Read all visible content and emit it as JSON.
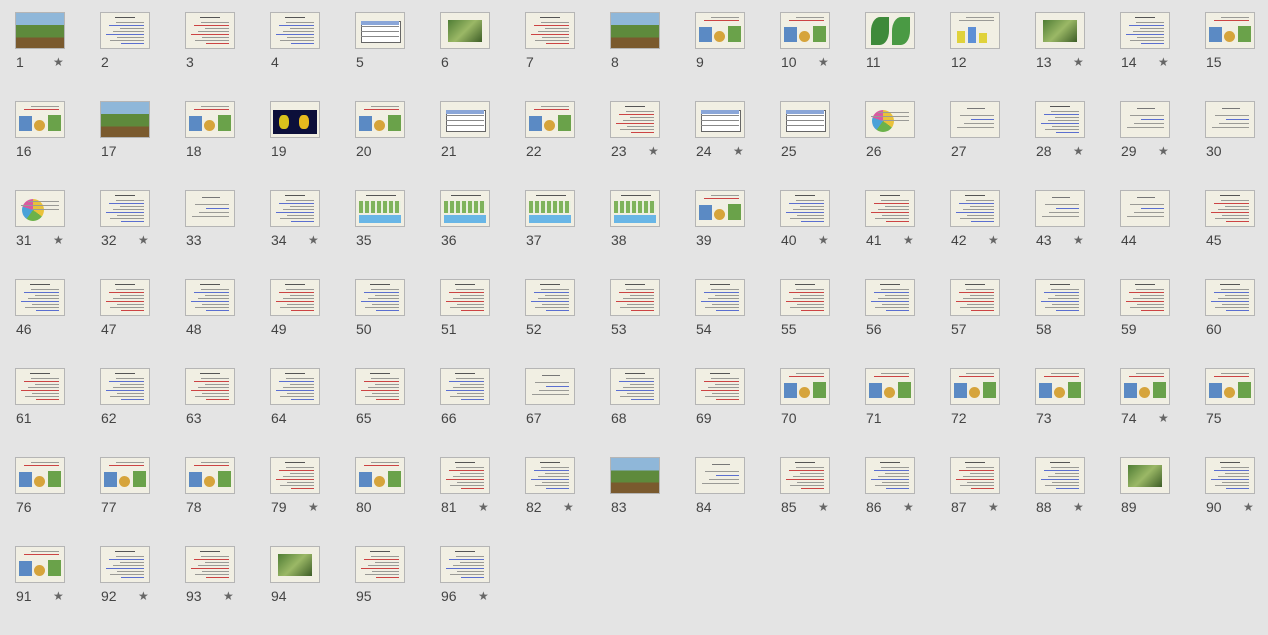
{
  "slides": [
    {
      "number": "1",
      "starred": true,
      "style": "photo"
    },
    {
      "number": "2",
      "starred": false,
      "style": "text"
    },
    {
      "number": "3",
      "starred": false,
      "style": "text"
    },
    {
      "number": "4",
      "starred": false,
      "style": "text"
    },
    {
      "number": "5",
      "starred": false,
      "style": "table"
    },
    {
      "number": "6",
      "starred": false,
      "style": "photo-small"
    },
    {
      "number": "7",
      "starred": false,
      "style": "text"
    },
    {
      "number": "8",
      "starred": false,
      "style": "photo"
    },
    {
      "number": "9",
      "starred": false,
      "style": "images"
    },
    {
      "number": "10",
      "starred": true,
      "style": "images"
    },
    {
      "number": "11",
      "starred": false,
      "style": "leaves"
    },
    {
      "number": "12",
      "starred": false,
      "style": "chart"
    },
    {
      "number": "13",
      "starred": true,
      "style": "photo-small"
    },
    {
      "number": "14",
      "starred": true,
      "style": "text"
    },
    {
      "number": "15",
      "starred": false,
      "style": "images"
    },
    {
      "number": "16",
      "starred": false,
      "style": "images"
    },
    {
      "number": "17",
      "starred": false,
      "style": "photo"
    },
    {
      "number": "18",
      "starred": false,
      "style": "images"
    },
    {
      "number": "19",
      "starred": false,
      "style": "dark"
    },
    {
      "number": "20",
      "starred": false,
      "style": "images"
    },
    {
      "number": "21",
      "starred": false,
      "style": "table"
    },
    {
      "number": "22",
      "starred": false,
      "style": "images"
    },
    {
      "number": "23",
      "starred": true,
      "style": "text"
    },
    {
      "number": "24",
      "starred": true,
      "style": "table"
    },
    {
      "number": "25",
      "starred": false,
      "style": "table"
    },
    {
      "number": "26",
      "starred": false,
      "style": "pie"
    },
    {
      "number": "27",
      "starred": false,
      "style": "text-sparse"
    },
    {
      "number": "28",
      "starred": true,
      "style": "text"
    },
    {
      "number": "29",
      "starred": true,
      "style": "text-sparse"
    },
    {
      "number": "30",
      "starred": false,
      "style": "text-sparse"
    },
    {
      "number": "31",
      "starred": true,
      "style": "pie"
    },
    {
      "number": "32",
      "starred": true,
      "style": "text"
    },
    {
      "number": "33",
      "starred": false,
      "style": "text-sparse"
    },
    {
      "number": "34",
      "starred": true,
      "style": "text"
    },
    {
      "number": "35",
      "starred": false,
      "style": "diagram"
    },
    {
      "number": "36",
      "starred": false,
      "style": "diagram"
    },
    {
      "number": "37",
      "starred": false,
      "style": "diagram"
    },
    {
      "number": "38",
      "starred": false,
      "style": "diagram"
    },
    {
      "number": "39",
      "starred": false,
      "style": "images"
    },
    {
      "number": "40",
      "starred": true,
      "style": "text"
    },
    {
      "number": "41",
      "starred": true,
      "style": "text"
    },
    {
      "number": "42",
      "starred": true,
      "style": "text"
    },
    {
      "number": "43",
      "starred": true,
      "style": "text-sparse"
    },
    {
      "number": "44",
      "starred": false,
      "style": "text-sparse"
    },
    {
      "number": "45",
      "starred": false,
      "style": "text"
    },
    {
      "number": "46",
      "starred": false,
      "style": "text"
    },
    {
      "number": "47",
      "starred": false,
      "style": "text"
    },
    {
      "number": "48",
      "starred": false,
      "style": "text"
    },
    {
      "number": "49",
      "starred": false,
      "style": "text"
    },
    {
      "number": "50",
      "starred": false,
      "style": "text"
    },
    {
      "number": "51",
      "starred": false,
      "style": "text"
    },
    {
      "number": "52",
      "starred": false,
      "style": "text"
    },
    {
      "number": "53",
      "starred": false,
      "style": "text"
    },
    {
      "number": "54",
      "starred": false,
      "style": "text"
    },
    {
      "number": "55",
      "starred": false,
      "style": "text"
    },
    {
      "number": "56",
      "starred": false,
      "style": "text"
    },
    {
      "number": "57",
      "starred": false,
      "style": "text"
    },
    {
      "number": "58",
      "starred": false,
      "style": "text"
    },
    {
      "number": "59",
      "starred": false,
      "style": "text"
    },
    {
      "number": "60",
      "starred": false,
      "style": "text"
    },
    {
      "number": "61",
      "starred": false,
      "style": "text"
    },
    {
      "number": "62",
      "starred": false,
      "style": "text"
    },
    {
      "number": "63",
      "starred": false,
      "style": "text"
    },
    {
      "number": "64",
      "starred": false,
      "style": "text"
    },
    {
      "number": "65",
      "starred": false,
      "style": "text"
    },
    {
      "number": "66",
      "starred": false,
      "style": "text"
    },
    {
      "number": "67",
      "starred": false,
      "style": "text-sparse"
    },
    {
      "number": "68",
      "starred": false,
      "style": "text"
    },
    {
      "number": "69",
      "starred": false,
      "style": "text"
    },
    {
      "number": "70",
      "starred": false,
      "style": "images"
    },
    {
      "number": "71",
      "starred": false,
      "style": "images"
    },
    {
      "number": "72",
      "starred": false,
      "style": "images"
    },
    {
      "number": "73",
      "starred": false,
      "style": "images"
    },
    {
      "number": "74",
      "starred": true,
      "style": "images"
    },
    {
      "number": "75",
      "starred": false,
      "style": "images"
    },
    {
      "number": "76",
      "starred": false,
      "style": "images"
    },
    {
      "number": "77",
      "starred": false,
      "style": "images"
    },
    {
      "number": "78",
      "starred": false,
      "style": "images"
    },
    {
      "number": "79",
      "starred": true,
      "style": "text"
    },
    {
      "number": "80",
      "starred": false,
      "style": "images"
    },
    {
      "number": "81",
      "starred": true,
      "style": "text"
    },
    {
      "number": "82",
      "starred": true,
      "style": "text"
    },
    {
      "number": "83",
      "starred": false,
      "style": "photo"
    },
    {
      "number": "84",
      "starred": false,
      "style": "text-sparse"
    },
    {
      "number": "85",
      "starred": true,
      "style": "text"
    },
    {
      "number": "86",
      "starred": true,
      "style": "text"
    },
    {
      "number": "87",
      "starred": true,
      "style": "text"
    },
    {
      "number": "88",
      "starred": true,
      "style": "text"
    },
    {
      "number": "89",
      "starred": false,
      "style": "photo-small"
    },
    {
      "number": "90",
      "starred": true,
      "style": "text"
    },
    {
      "number": "91",
      "starred": true,
      "style": "images"
    },
    {
      "number": "92",
      "starred": true,
      "style": "text"
    },
    {
      "number": "93",
      "starred": true,
      "style": "text"
    },
    {
      "number": "94",
      "starred": false,
      "style": "photo-small"
    },
    {
      "number": "95",
      "starred": false,
      "style": "text"
    },
    {
      "number": "96",
      "starred": true,
      "style": "text"
    }
  ],
  "icons": {
    "animation_marker": "star-icon"
  },
  "colors": {
    "background": "#e4e4e4",
    "slide_background": "#f1efe3",
    "text": "#444444"
  }
}
